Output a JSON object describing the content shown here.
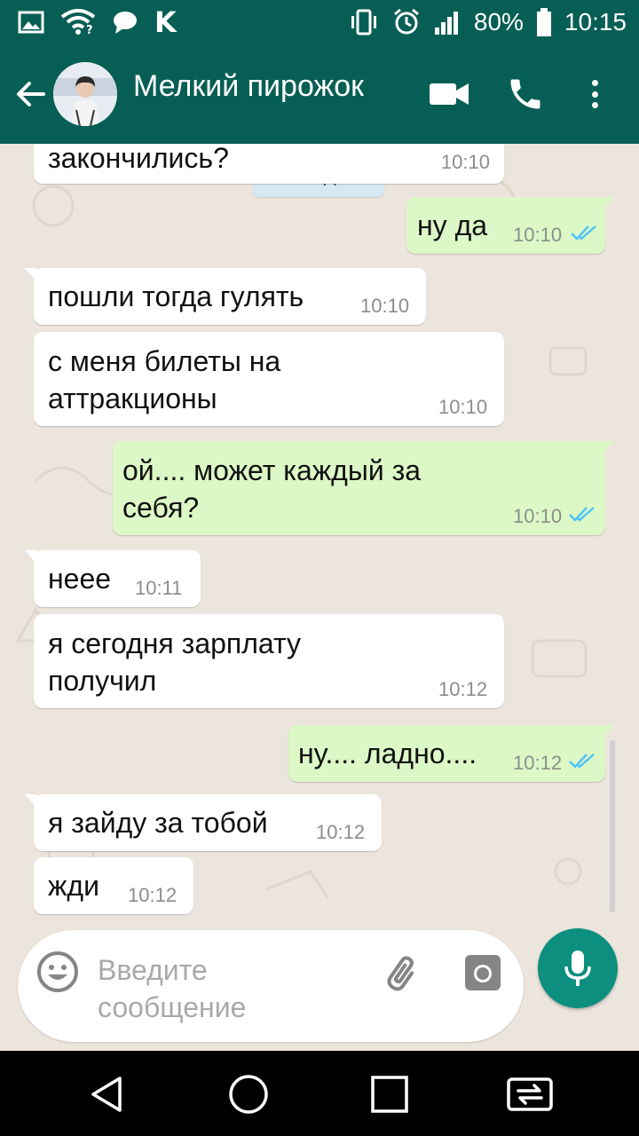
{
  "status_bar": {
    "battery_percent": "80%",
    "time": "10:15",
    "icons": [
      "image-icon",
      "wifi-question-icon",
      "chat-bubble-icon",
      "k-app-icon",
      "vibrate-icon",
      "alarm-icon",
      "signal-icon",
      "battery-icon"
    ]
  },
  "header": {
    "contact_name": "Мелкий пирожок",
    "icons": [
      "back-arrow-icon",
      "avatar",
      "video-call-icon",
      "phone-icon",
      "more-vert-icon"
    ]
  },
  "chat": {
    "date_chip": "Сегодня",
    "messages": [
      {
        "direction": "in",
        "text": "закончились?",
        "time": "10:10",
        "partial": true
      },
      {
        "direction": "out",
        "text": "ну да",
        "time": "10:10",
        "status": "read"
      },
      {
        "direction": "in",
        "text": "пошли тогда гулять",
        "time": "10:10"
      },
      {
        "direction": "in",
        "text": "с меня билеты на\nаттракционы",
        "time": "10:10"
      },
      {
        "direction": "out",
        "text": "ой.... может каждый за\nсебя?",
        "time": "10:10",
        "status": "read"
      },
      {
        "direction": "in",
        "text": "неее",
        "time": "10:11"
      },
      {
        "direction": "in",
        "text": "я сегодня зарплату\nполучил",
        "time": "10:12"
      },
      {
        "direction": "out",
        "text": "ну.... ладно....",
        "time": "10:12",
        "status": "read"
      },
      {
        "direction": "in",
        "text": "я зайду за тобой",
        "time": "10:12"
      },
      {
        "direction": "in",
        "text": "жди",
        "time": "10:12"
      }
    ]
  },
  "input": {
    "placeholder": "Введите\nсообщение",
    "icons": [
      "emoji-icon",
      "paperclip-icon",
      "camera-icon",
      "mic-icon"
    ]
  },
  "nav_bar": {
    "icons": [
      "back-triangle-icon",
      "home-circle-icon",
      "recents-square-icon",
      "switch-app-icon"
    ]
  },
  "colors": {
    "header_bg": "#075E54",
    "chat_bg": "#ECE5DD",
    "outgoing_bubble": "#DCF8C6",
    "incoming_bubble": "#FFFFFF",
    "read_ticks": "#4FC3F7",
    "mic_button": "#0C8F7E",
    "date_chip_bg": "#D6E9F2"
  }
}
